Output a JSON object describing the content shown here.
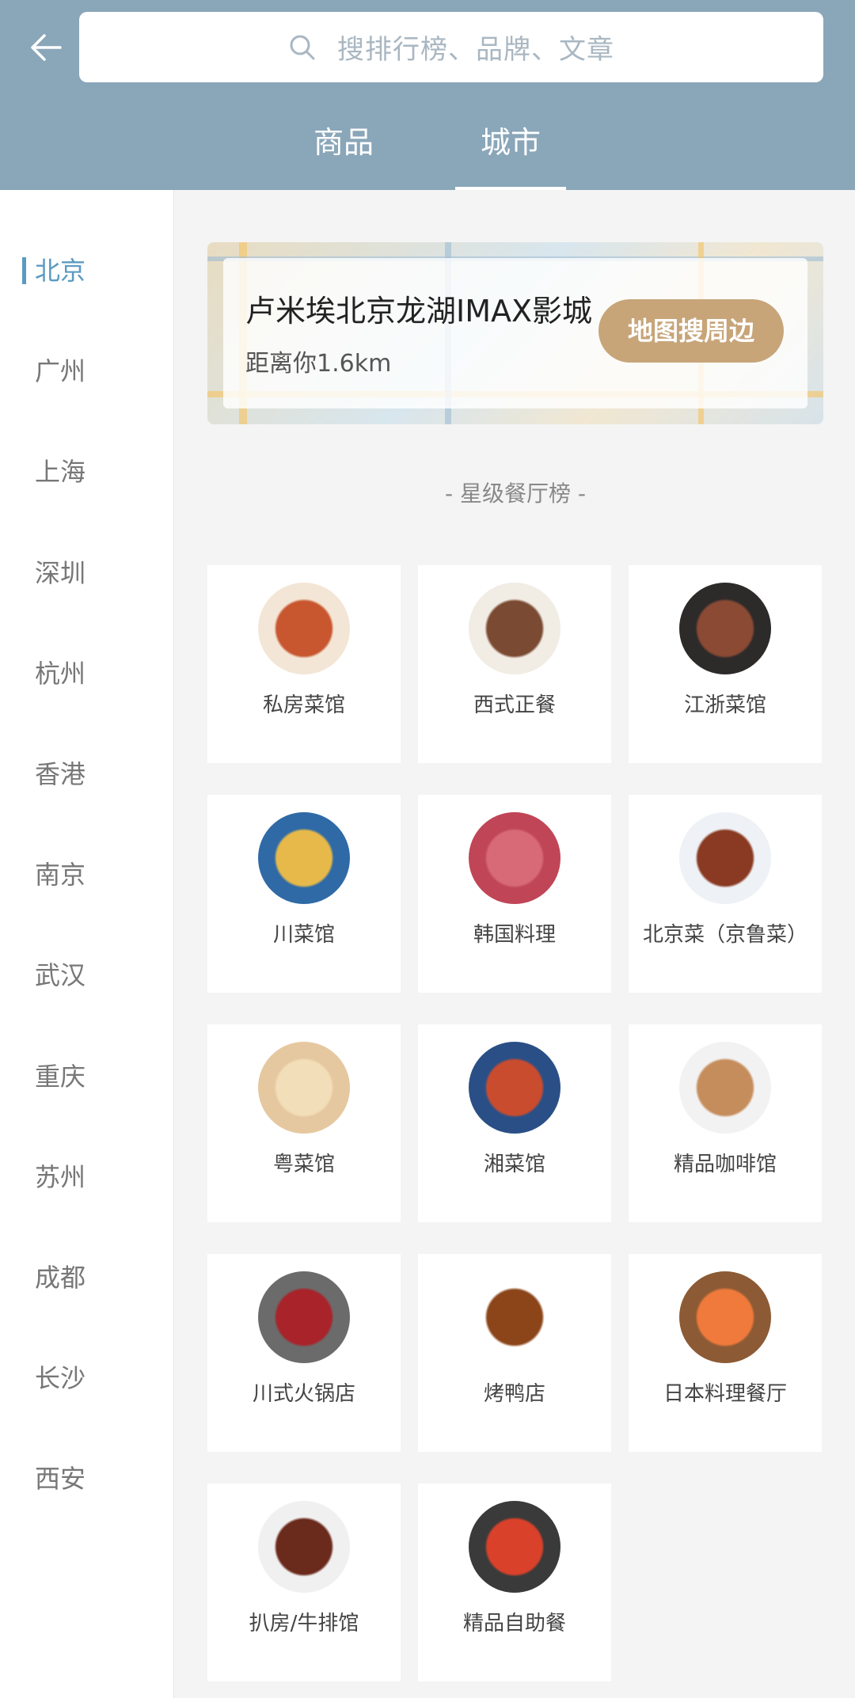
{
  "header": {
    "search_placeholder": "搜排行榜、品牌、文章",
    "tabs": [
      {
        "label": "商品",
        "active": false
      },
      {
        "label": "城市",
        "active": true
      }
    ]
  },
  "sidebar": {
    "cities": [
      "北京",
      "广州",
      "上海",
      "深圳",
      "杭州",
      "香港",
      "南京",
      "武汉",
      "重庆",
      "苏州",
      "成都",
      "长沙",
      "西安"
    ],
    "active_city": "北京"
  },
  "location_card": {
    "name": "卢米埃北京龙湖IMAX影城",
    "distance": "距离你1.6km",
    "button_label": "地图搜周边"
  },
  "section_title": "- 星级餐厅榜 -",
  "categories": [
    {
      "label": "私房菜馆",
      "icon": "private-kitchen-dish-icon",
      "plate": "#f3e6d6",
      "food": "#c8562e"
    },
    {
      "label": "西式正餐",
      "icon": "western-steak-dish-icon",
      "plate": "#f1ece4",
      "food": "#7b4a32"
    },
    {
      "label": "江浙菜馆",
      "icon": "jiangzhe-dish-icon",
      "plate": "#2d2a2a",
      "food": "#8a4a34"
    },
    {
      "label": "川菜馆",
      "icon": "sichuan-dish-icon",
      "plate": "#2f6aa6",
      "food": "#e6b94a"
    },
    {
      "label": "韩国料理",
      "icon": "korean-beef-dish-icon",
      "plate": "#c04557",
      "food": "#d86a78"
    },
    {
      "label": "北京菜（京鲁菜）",
      "icon": "beijing-dish-icon",
      "plate": "#eef1f5",
      "food": "#8a3a22"
    },
    {
      "label": "粤菜馆",
      "icon": "cantonese-chicken-dish-icon",
      "plate": "#e6c8a0",
      "food": "#f2deb8"
    },
    {
      "label": "湘菜馆",
      "icon": "hunan-dish-icon",
      "plate": "#2a4f86",
      "food": "#c94c2e"
    },
    {
      "label": "精品咖啡馆",
      "icon": "coffee-latte-icon",
      "plate": "#f2f2f2",
      "food": "#c68d5c"
    },
    {
      "label": "川式火锅店",
      "icon": "hotpot-icon",
      "plate": "#6b6b6b",
      "food": "#a8232a"
    },
    {
      "label": "烤鸭店",
      "icon": "roast-duck-icon",
      "plate": "#ffffff",
      "food": "#8c4519"
    },
    {
      "label": "日本料理餐厅",
      "icon": "sushi-dish-icon",
      "plate": "#8c5a34",
      "food": "#f07a3c"
    },
    {
      "label": "扒房/牛排馆",
      "icon": "steakhouse-dish-icon",
      "plate": "#f0f0f0",
      "food": "#6a2a1c"
    },
    {
      "label": "精品自助餐",
      "icon": "buffet-dish-icon",
      "plate": "#3a3a3a",
      "food": "#d9412b"
    }
  ]
}
